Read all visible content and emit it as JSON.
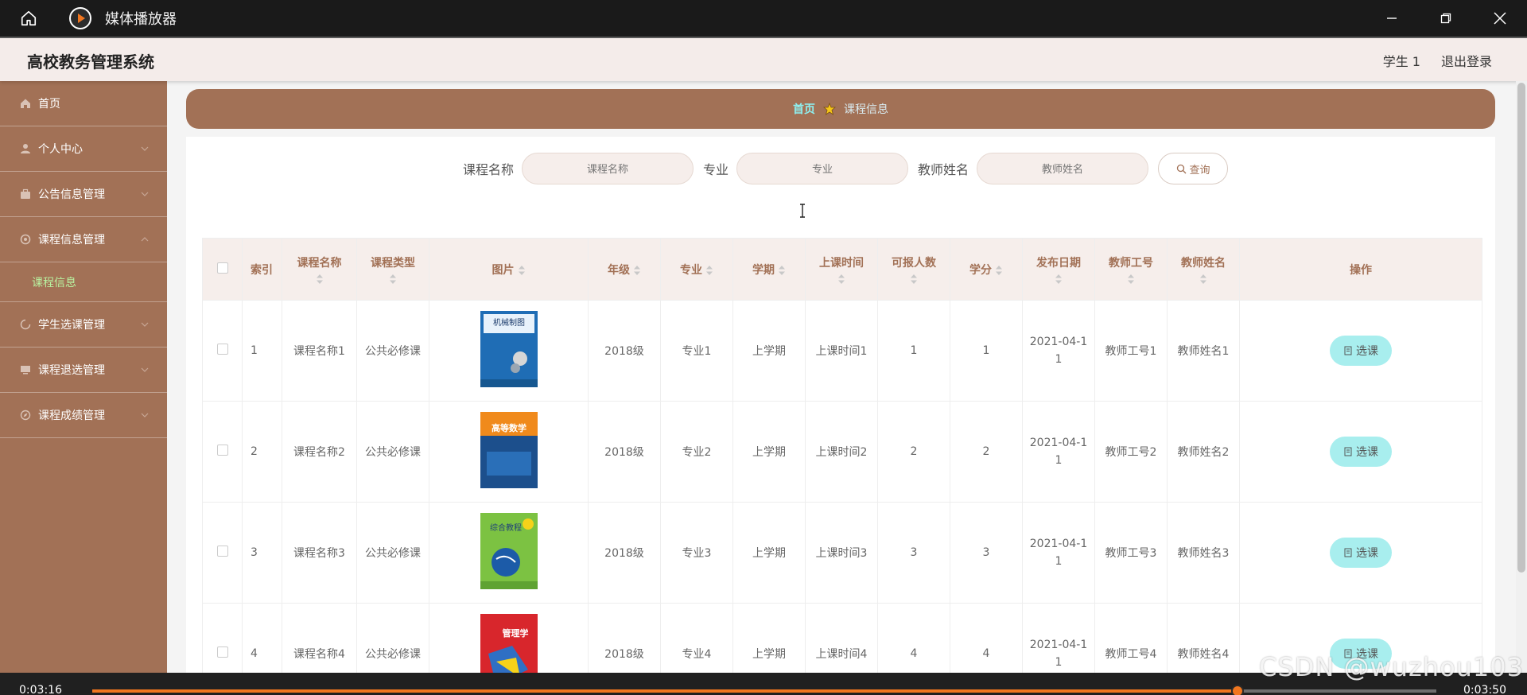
{
  "player": {
    "title": "媒体播放器",
    "time_current": "0:03:16",
    "time_total": "0:03:50",
    "progress": 0.852
  },
  "header": {
    "system_title": "高校教务管理系统",
    "user": "学生 1",
    "logout": "退出登录"
  },
  "sidebar": {
    "items": [
      {
        "label": "首页",
        "icon": "home-icon"
      },
      {
        "label": "个人中心",
        "icon": "user-icon"
      },
      {
        "label": "公告信息管理",
        "icon": "briefcase-icon"
      },
      {
        "label": "课程信息管理",
        "icon": "settings-icon"
      },
      {
        "label": "课程信息",
        "icon": ""
      },
      {
        "label": "学生选课管理",
        "icon": "loading-icon"
      },
      {
        "label": "课程退选管理",
        "icon": "monitor-icon"
      },
      {
        "label": "课程成绩管理",
        "icon": "compass-icon"
      }
    ]
  },
  "breadcrumb": {
    "home": "首页",
    "current": "课程信息"
  },
  "search": {
    "course_label": "课程名称",
    "course_placeholder": "课程名称",
    "major_label": "专业",
    "major_placeholder": "专业",
    "teacher_label": "教师姓名",
    "teacher_placeholder": "教师姓名",
    "button": "查询"
  },
  "table": {
    "columns": [
      "索引",
      "课程名称",
      "课程类型",
      "图片",
      "年级",
      "专业",
      "学期",
      "上课时间",
      "可报人数",
      "学分",
      "发布日期",
      "教师工号",
      "教师姓名",
      "操作"
    ],
    "rows": [
      {
        "index": "1",
        "name": "课程名称1",
        "type": "公共必修课",
        "image": "机械制图",
        "grade": "2018级",
        "major": "专业1",
        "term": "上学期",
        "time": "上课时间1",
        "capacity": "1",
        "credit": "1",
        "date": "2021-04-11",
        "teacher_id": "教师工号1",
        "teacher_name": "教师姓名1",
        "action": "选课"
      },
      {
        "index": "2",
        "name": "课程名称2",
        "type": "公共必修课",
        "image": "高等数学",
        "grade": "2018级",
        "major": "专业2",
        "term": "上学期",
        "time": "上课时间2",
        "capacity": "2",
        "credit": "2",
        "date": "2021-04-11",
        "teacher_id": "教师工号2",
        "teacher_name": "教师姓名2",
        "action": "选课"
      },
      {
        "index": "3",
        "name": "课程名称3",
        "type": "公共必修课",
        "image": "综合教程",
        "grade": "2018级",
        "major": "专业3",
        "term": "上学期",
        "time": "上课时间3",
        "capacity": "3",
        "credit": "3",
        "date": "2021-04-11",
        "teacher_id": "教师工号3",
        "teacher_name": "教师姓名3",
        "action": "选课"
      },
      {
        "index": "4",
        "name": "课程名称4",
        "type": "公共必修课",
        "image": "管理学",
        "grade": "2018级",
        "major": "专业4",
        "term": "上学期",
        "time": "上课时间4",
        "capacity": "4",
        "credit": "4",
        "date": "2021-04-11",
        "teacher_id": "教师工号4",
        "teacher_name": "教师姓名4",
        "action": "选课"
      }
    ]
  },
  "watermark": "CSDN @wuzhou103",
  "colors": {
    "accent": "#a27156",
    "header_bg": "#f4ecea",
    "button_bg": "#a8eeee",
    "progress": "#f0761f"
  }
}
